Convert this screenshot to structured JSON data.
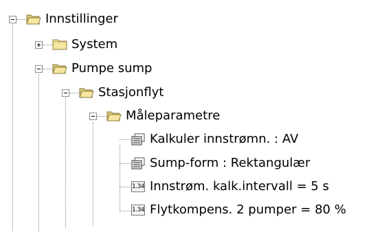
{
  "tree": {
    "root": {
      "label": "Innstillinger",
      "expanded": true
    },
    "system": {
      "label": "System",
      "expanded": false
    },
    "pumpe_sump": {
      "label": "Pumpe sump",
      "expanded": true
    },
    "stasjonflyt": {
      "label": "Stasjonflyt",
      "expanded": true
    },
    "maleparametre": {
      "label": "Måleparametre",
      "expanded": true
    },
    "params": [
      {
        "label": "Kalkuler innstrømn. : AV",
        "icon": "list-icon"
      },
      {
        "label": "Sump-form : Rektangulær",
        "icon": "list-icon"
      },
      {
        "label": "Innstrøm. kalk.intervall = 5 s",
        "icon": "number-icon",
        "icon_text": "1.34"
      },
      {
        "label": "Flytkompens. 2 pumper = 80 %",
        "icon": "number-icon",
        "icon_text": "1.34"
      }
    ]
  },
  "colors": {
    "folder": "#f5e6a0",
    "folder_dark": "#c9b25a",
    "folder_open_inner": "#ffffff",
    "line": "#8a8a8a"
  }
}
